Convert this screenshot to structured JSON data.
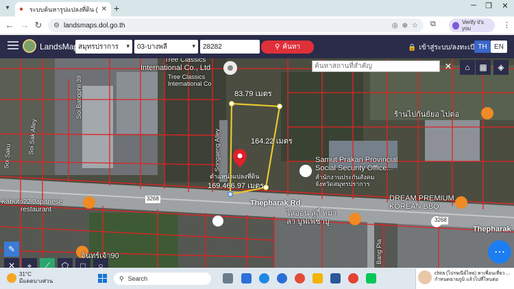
{
  "browser": {
    "tab_title": "ระบบค้นหารูปแปลงที่ดิน (LandsMap",
    "new_tab": "+",
    "url": "landsmaps.dol.go.th",
    "verify_label": "Verify it's you"
  },
  "app": {
    "brand": "LandsMaps",
    "province": "สมุทรปราการ",
    "district": "03-บางพลี",
    "parcel_number": "28282",
    "search_button": "ค้นหา",
    "login_label": "เข้าสู่ระบบ/ลงทะเบียน",
    "lang_th": "TH",
    "lang_en": "EN"
  },
  "map": {
    "search_placeholder": "ค้นหาสถานที่สำคัญ",
    "parcel_top_length": "83.79 เมตร",
    "parcel_right_length": "164.22 เมตร",
    "parcel_bottom_length": "169.466.97 เมตร",
    "parcel_position_label": "ตำแหน่งแปลงที่ดิน",
    "labels": {
      "tree_classics_1": "Tree Classics",
      "tree_classics_2": "International Co., Ltd",
      "tree_classics_3": "Tree Classics",
      "tree_classics_4": "International Co",
      "shop_thai": "ร้านไปกันยัยอ ไปต่อ",
      "samut_prakan_1": "Samut Prakan Provincial",
      "samut_prakan_2": "Social Security Office...",
      "samut_prakan_th_1": "สำนักงานประกันสังคม",
      "samut_prakan_th_2": "จังหวัดสมุทรปราการ",
      "dream_premium_1": "DREAM PREMIUM",
      "dream_premium_2": "KOREAN BBQ",
      "thepharak_rd": "Thepharak Rd",
      "thepharak_right": "Thepharak",
      "road_3268_a": "3268",
      "road_3268_b": "3268",
      "lalon_1": "ไลออน สุกี้ หม่า",
      "lalon_2": "ลา บูฟเฟ่ชาบู",
      "kabuto_1": "Kabuto22 Japanese",
      "kabuto_2": "restaurant",
      "soi_bangphli": "Soi Bangphli 39",
      "soi_saku": "Soi Saku",
      "soi_sak_alley": "Soi Sak Alley",
      "bang_pla": "Bang Pla",
      "songaeng_alley": "Songaeng Alley",
      "chanthri": "จันทร์เจ้า90"
    }
  },
  "taskbar": {
    "temperature": "31°C",
    "weather_desc": "มีแดดบางส่วน",
    "search_placeholder": "Search",
    "notif_title": "chira (ไปรษณีย์ไทย) หาเพื่อนเที่ยว ...",
    "notif_body": "กำหนดฉายภูมิ แล้วไปที่ไหนต่อ"
  },
  "colors": {
    "header_bg": "#2a2c4a",
    "search_btn": "#e0303a",
    "parcel_outline": "#e8c630",
    "boundary_lines": "#e32222",
    "marker": "#e0202a"
  }
}
